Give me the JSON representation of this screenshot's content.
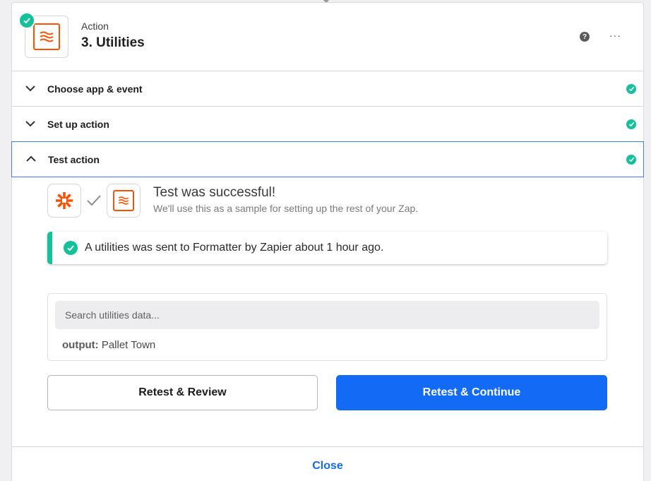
{
  "header": {
    "kicker": "Action",
    "title": "3. Utilities",
    "help_icon": "?",
    "more_icon": "···"
  },
  "steps": [
    {
      "label": "Choose app & event",
      "expanded": false,
      "complete": true
    },
    {
      "label": "Set up action",
      "expanded": false,
      "complete": true
    },
    {
      "label": "Test action",
      "expanded": true,
      "complete": true
    }
  ],
  "test": {
    "title": "Test was successful!",
    "subtitle": "We'll use this as a sample for setting up the rest of your Zap.",
    "alert": "A utilities was sent to Formatter by Zapier about 1 hour ago.",
    "search_placeholder": "Search utilities data...",
    "output_key": "output:",
    "output_value": "Pallet Town",
    "retest_review": "Retest & Review",
    "retest_continue": "Retest & Continue"
  },
  "footer": {
    "close": "Close"
  },
  "colors": {
    "success": "#13c19a",
    "brand_orange": "#ff4f00",
    "primary_blue": "#136bf5",
    "active_border": "#3f7fde"
  },
  "icons": [
    "formatter-icon",
    "check-icon",
    "chevron-down-icon",
    "chevron-up-icon",
    "zapier-logo-icon",
    "help-icon",
    "more-icon"
  ]
}
